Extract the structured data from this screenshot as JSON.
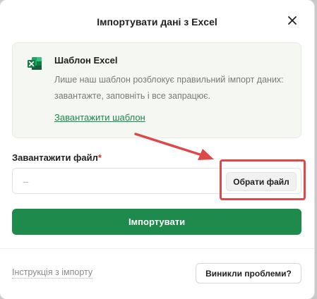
{
  "dialog": {
    "title": "Імпортувати дані з Excel"
  },
  "template": {
    "icon": "excel-icon",
    "title": "Шаблон Excel",
    "description": "Лише наш шаблон розблокує правильний імпорт даних: завантажте, заповніть і все запрацює.",
    "download_link": "Завантажити шаблон"
  },
  "file": {
    "label": "Завантажити файл",
    "required_mark": "*",
    "value": "–",
    "choose_button": "Обрати файл"
  },
  "actions": {
    "import_button": "Імпортувати",
    "instructions_link": "Інструкція з імпорту",
    "problems_button": "Виникли проблеми?"
  },
  "colors": {
    "accent_green": "#1e8a4b",
    "annotation_red": "#dd4848"
  }
}
